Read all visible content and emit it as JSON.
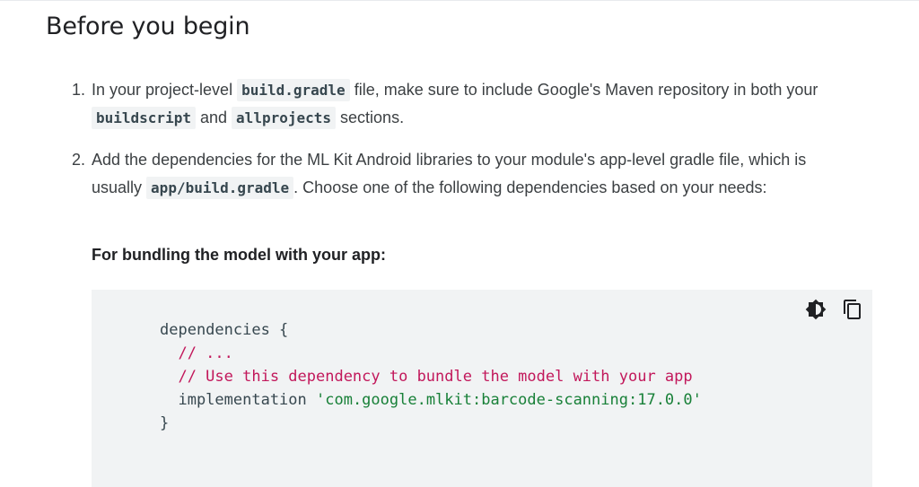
{
  "section": {
    "title": "Before you begin"
  },
  "steps": [
    {
      "num": "1.",
      "t1": "In your project-level",
      "c1": "build.gradle",
      "t2": "file, make sure to include Google's Maven repository in both your",
      "c2": "buildscript",
      "t3": "and",
      "c3": "allprojects",
      "t4": "sections."
    },
    {
      "num": "2.",
      "t1": "Add the dependencies for the ML Kit Android libraries to your module's app-level gradle file, which is usually",
      "c1": "app/build.gradle",
      "t2": ". Choose one of the following dependencies based on your needs:"
    }
  ],
  "bundling_heading": "For bundling the model with your app:",
  "code": {
    "line1": "dependencies {",
    "line2": "  // ...",
    "line3": "  // Use this dependency to bundle the model with your app",
    "line4_keyword": "  implementation ",
    "line4_string": "'com.google.mlkit:barcode-scanning:17.0.0'",
    "line5": "}"
  },
  "code_toolbar": {
    "theme_icon": "dark-mode-icon",
    "copy_icon": "copy-icon"
  },
  "colors": {
    "comment": "#c2185b",
    "string": "#188038",
    "code_bg": "#f1f3f4"
  }
}
